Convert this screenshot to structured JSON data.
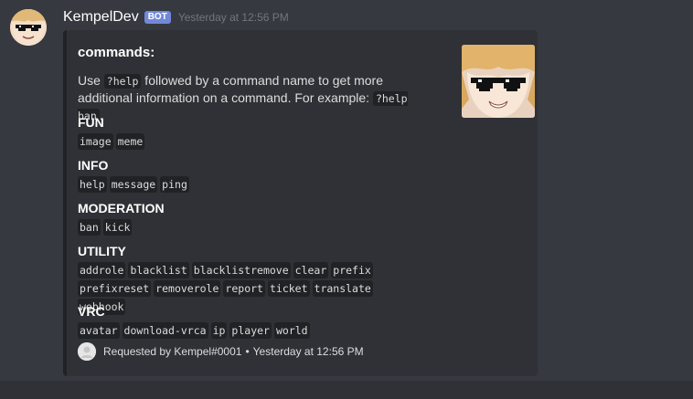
{
  "message": {
    "username": "KempelDev",
    "bot_tag": "BOT",
    "timestamp": "Yesterday at 12:56 PM"
  },
  "embed": {
    "title": "commands:",
    "description": {
      "part1": "Use ",
      "code1": "?help",
      "part2": " followed by a command name to get more additional information on a command. For example: ",
      "code2": "?help ban",
      "part3": "."
    },
    "fields": [
      {
        "name": "FUN",
        "values": [
          "image",
          "meme"
        ]
      },
      {
        "name": "INFO",
        "values": [
          "help",
          "message",
          "ping"
        ]
      },
      {
        "name": "MODERATION",
        "values": [
          "ban",
          "kick"
        ]
      },
      {
        "name": "UTILITY",
        "values": [
          "addrole",
          "blacklist",
          "blacklistremove",
          "clear",
          "prefix",
          "prefixreset",
          "removerole",
          "report",
          "ticket",
          "translate",
          "webhook"
        ]
      },
      {
        "name": "VRC",
        "values": [
          "avatar",
          "download-vrca",
          "ip",
          "player",
          "world"
        ]
      }
    ],
    "footer": {
      "text": "Requested by Kempel#0001",
      "separator": "•",
      "timestamp": "Yesterday at 12:56 PM"
    }
  },
  "colors": {
    "background": "#36393f",
    "embed_background": "#2f3136",
    "embed_border": "#202225",
    "bot_tag": "#7289da",
    "code_background": "#202225"
  },
  "icons": {
    "avatar": "anime-avatar-with-pixel-sunglasses",
    "thumbnail": "anime-thumbnail-with-pixel-sunglasses",
    "footer_icon": "user-avatar-icon"
  }
}
